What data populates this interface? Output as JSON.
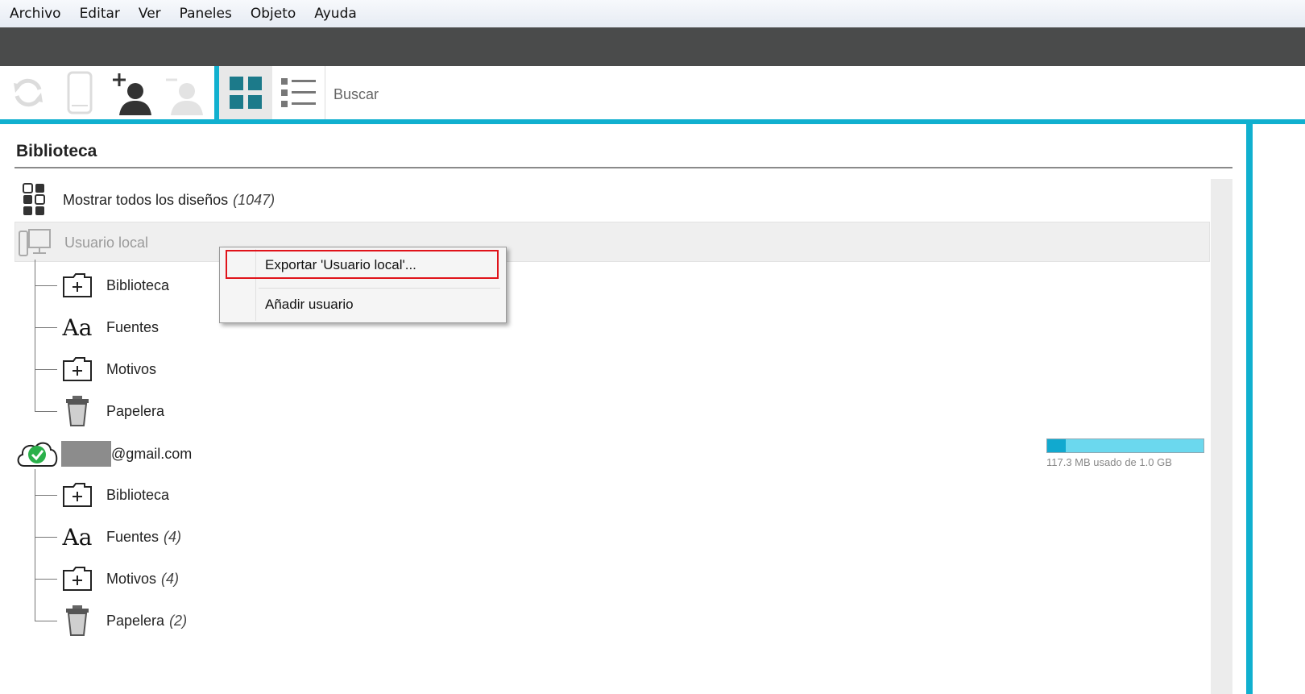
{
  "menu": {
    "items": [
      "Archivo",
      "Editar",
      "Ver",
      "Paneles",
      "Objeto",
      "Ayuda"
    ]
  },
  "toolbar": {
    "icons": [
      "sync-icon",
      "device-icon",
      "add-user-icon",
      "remove-user-icon",
      "grid-view-icon",
      "list-view-icon"
    ],
    "search_placeholder": "Buscar"
  },
  "library": {
    "title": "Biblioteca",
    "show_all": {
      "label": "Mostrar todos los diseños",
      "count": "(1047)"
    },
    "local_user": {
      "label": "Usuario local",
      "children": [
        {
          "label": "Biblioteca",
          "count": ""
        },
        {
          "label": "Fuentes",
          "count": ""
        },
        {
          "label": "Motivos",
          "count": ""
        },
        {
          "label": "Papelera",
          "count": ""
        }
      ]
    },
    "cloud_user": {
      "email_suffix": "@gmail.com",
      "storage_text": "117.3 MB usado de 1.0 GB",
      "storage_fraction": 0.117,
      "children": [
        {
          "label": "Biblioteca",
          "count": ""
        },
        {
          "label": "Fuentes",
          "count": "(4)"
        },
        {
          "label": "Motivos",
          "count": "(4)"
        },
        {
          "label": "Papelera",
          "count": "(2)"
        }
      ]
    }
  },
  "context_menu": {
    "export_label": "Exportar 'Usuario local'...",
    "add_user_label": "Añadir usuario"
  },
  "colors": {
    "accent": "#11b0cf",
    "highlight": "#e0131a",
    "dark_bar": "#4a4b4b"
  }
}
